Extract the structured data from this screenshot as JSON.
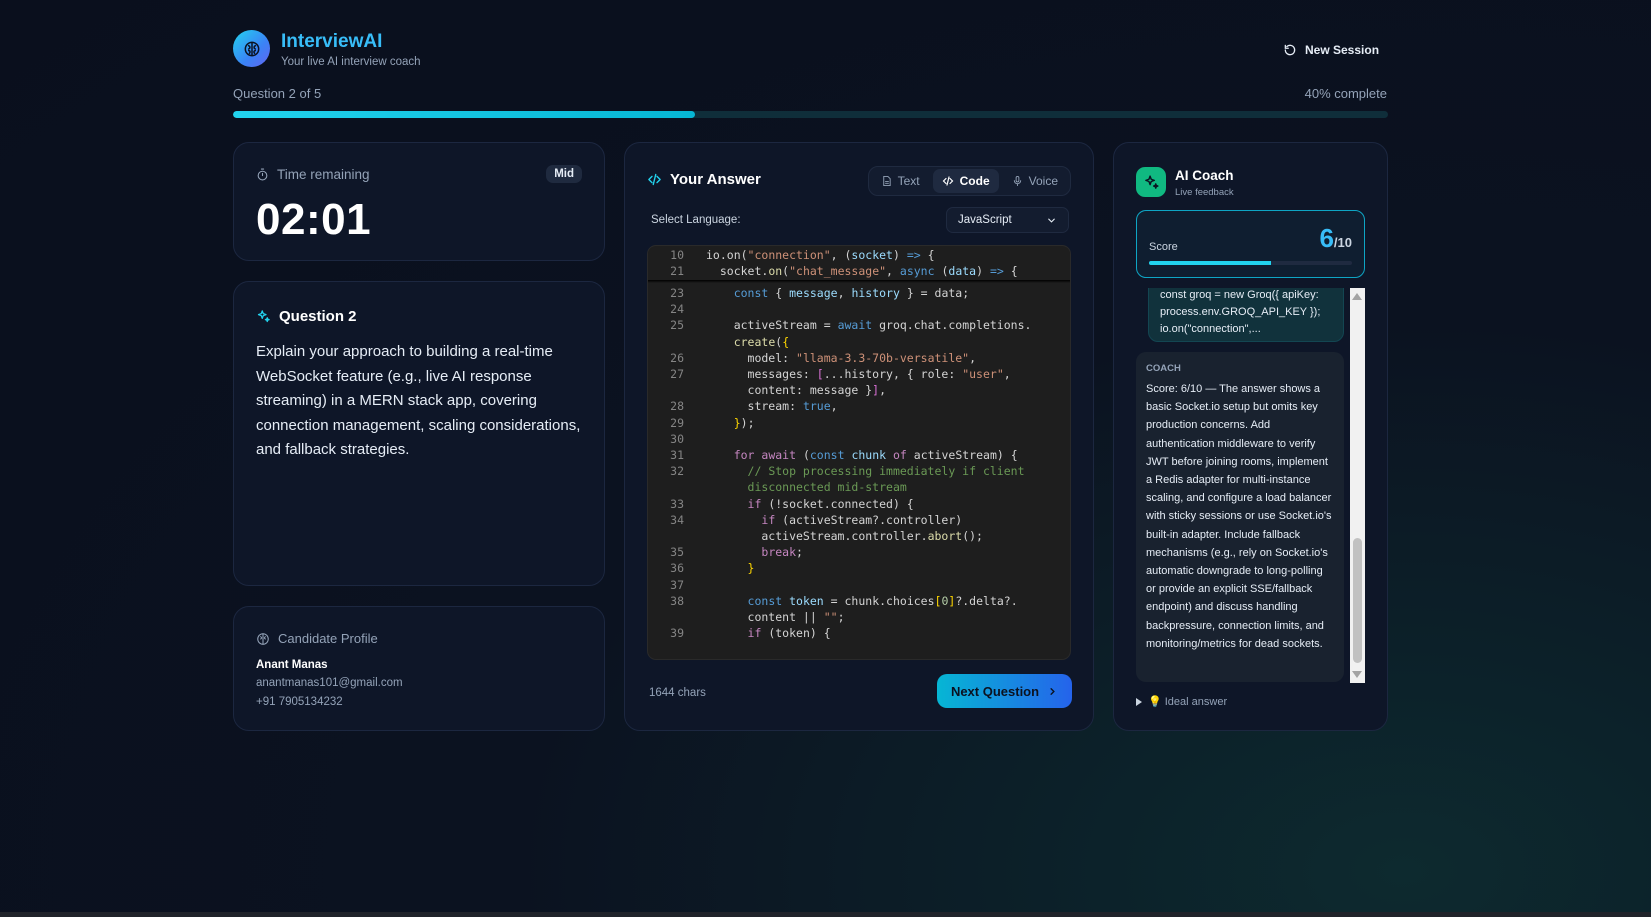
{
  "app": {
    "title": "InterviewAI",
    "tagline": "Your live AI interview coach",
    "new_session_label": "New Session"
  },
  "progress": {
    "question_label": "Question 2 of 5",
    "percent_label": "40% complete",
    "percent": 40
  },
  "timer": {
    "label": "Time remaining",
    "badge": "Mid",
    "value": "02:01"
  },
  "question": {
    "title": "Question 2",
    "text": "Explain your approach to building a real-time WebSocket feature (e.g., live AI response streaming) in a MERN stack app, covering connection management, scaling considerations, and fallback strategies."
  },
  "profile": {
    "title": "Candidate Profile",
    "name": "Anant Manas",
    "email": "anantmanas101@gmail.com",
    "phone": "+91 7905134232"
  },
  "answer": {
    "title": "Your Answer",
    "tabs": [
      {
        "label": "Text",
        "active": false
      },
      {
        "label": "Code",
        "active": true
      },
      {
        "label": "Voice",
        "active": false
      }
    ],
    "language_label": "Select Language:",
    "language_value": "JavaScript",
    "char_count": "1644 chars",
    "next_label": "Next Question",
    "code_lines": [
      {
        "n": "10",
        "html": "io.on(<span class=\"str\">\"connection\"</span>, (<span class=\"var\">socket</span>) <span class=\"kw\">=&gt;</span> {"
      },
      {
        "n": "21",
        "html": "  socket.<span class=\"fn\">on</span>(<span class=\"str\">\"chat_message\"</span>, <span class=\"kw\">async</span> (<span class=\"var\">data</span>) <span class=\"kw\">=&gt;</span> {"
      },
      {
        "n": "23",
        "html": "    <span class=\"kw\">const</span> { <span class=\"var\">message</span>, <span class=\"var\">history</span> } = data;"
      },
      {
        "n": "24",
        "html": ""
      },
      {
        "n": "25",
        "html": "    activeStream = <span class=\"kw\">await</span> groq.chat.completions."
      },
      {
        "n": "",
        "html": "    <span class=\"fn\">create</span>(<span class=\"br\">{</span>"
      },
      {
        "n": "26",
        "html": "      model: <span class=\"str\">\"llama-3.3-70b-versatile\"</span>,"
      },
      {
        "n": "27",
        "html": "      messages: <span class=\"br2\">[</span>...history, { role: <span class=\"str\">\"user\"</span>,"
      },
      {
        "n": "",
        "html": "      content: message }<span class=\"br2\">]</span>,"
      },
      {
        "n": "28",
        "html": "      stream: <span class=\"kw\">true</span>,"
      },
      {
        "n": "29",
        "html": "    <span class=\"br\">}</span>);"
      },
      {
        "n": "30",
        "html": ""
      },
      {
        "n": "31",
        "html": "    <span class=\"kw2\">for await</span> (<span class=\"kw\">const</span> <span class=\"var\">chunk</span> <span class=\"kw2\">of</span> activeStream) {"
      },
      {
        "n": "32",
        "html": "      <span class=\"cmt\">// Stop processing immediately if client</span>"
      },
      {
        "n": "",
        "html": "      <span class=\"cmt\">disconnected mid-stream</span>"
      },
      {
        "n": "33",
        "html": "      <span class=\"kw2\">if</span> (!socket.connected) {"
      },
      {
        "n": "34",
        "html": "        <span class=\"kw2\">if</span> (activeStream?.controller)"
      },
      {
        "n": "",
        "html": "        activeStream.controller.<span class=\"fn\">abort</span>();"
      },
      {
        "n": "35",
        "html": "        <span class=\"kw2\">break</span>;"
      },
      {
        "n": "36",
        "html": "      <span class=\"br\">}</span>"
      },
      {
        "n": "37",
        "html": ""
      },
      {
        "n": "38",
        "html": "      <span class=\"kw\">const</span> <span class=\"var\">token</span> = chunk.choices<span class=\"br\">[</span><span class=\"num\">0</span><span class=\"br\">]</span>?.delta?."
      },
      {
        "n": "",
        "html": "      content || <span class=\"str\">\"\"</span>;"
      },
      {
        "n": "39",
        "html": "      <span class=\"kw2\">if</span> (token) {"
      }
    ]
  },
  "coach": {
    "title": "AI Coach",
    "subtitle": "Live feedback",
    "score_label": "Score",
    "score_value": "6",
    "score_max": "/10",
    "score_fraction": 0.6,
    "user_snippet": "const groq = new Groq({ apiKey: process.env.GROQ_API_KEY }); io.on(\"connection\",...",
    "coach_tag": "COACH",
    "feedback": "Score: 6/10 — The answer shows a basic Socket.io setup but omits key production concerns. Add authentication middleware to verify JWT before joining rooms, implement a Redis adapter for multi-instance scaling, and configure a load balancer with sticky sessions or use Socket.io's built-in adapter. Include fallback mechanisms (e.g., rely on Socket.io's automatic downgrade to long-polling or provide an explicit SSE/fallback endpoint) and discuss handling backpressure, connection limits, and monitoring/metrics for dead sockets.",
    "ideal_label": "💡 Ideal answer"
  }
}
